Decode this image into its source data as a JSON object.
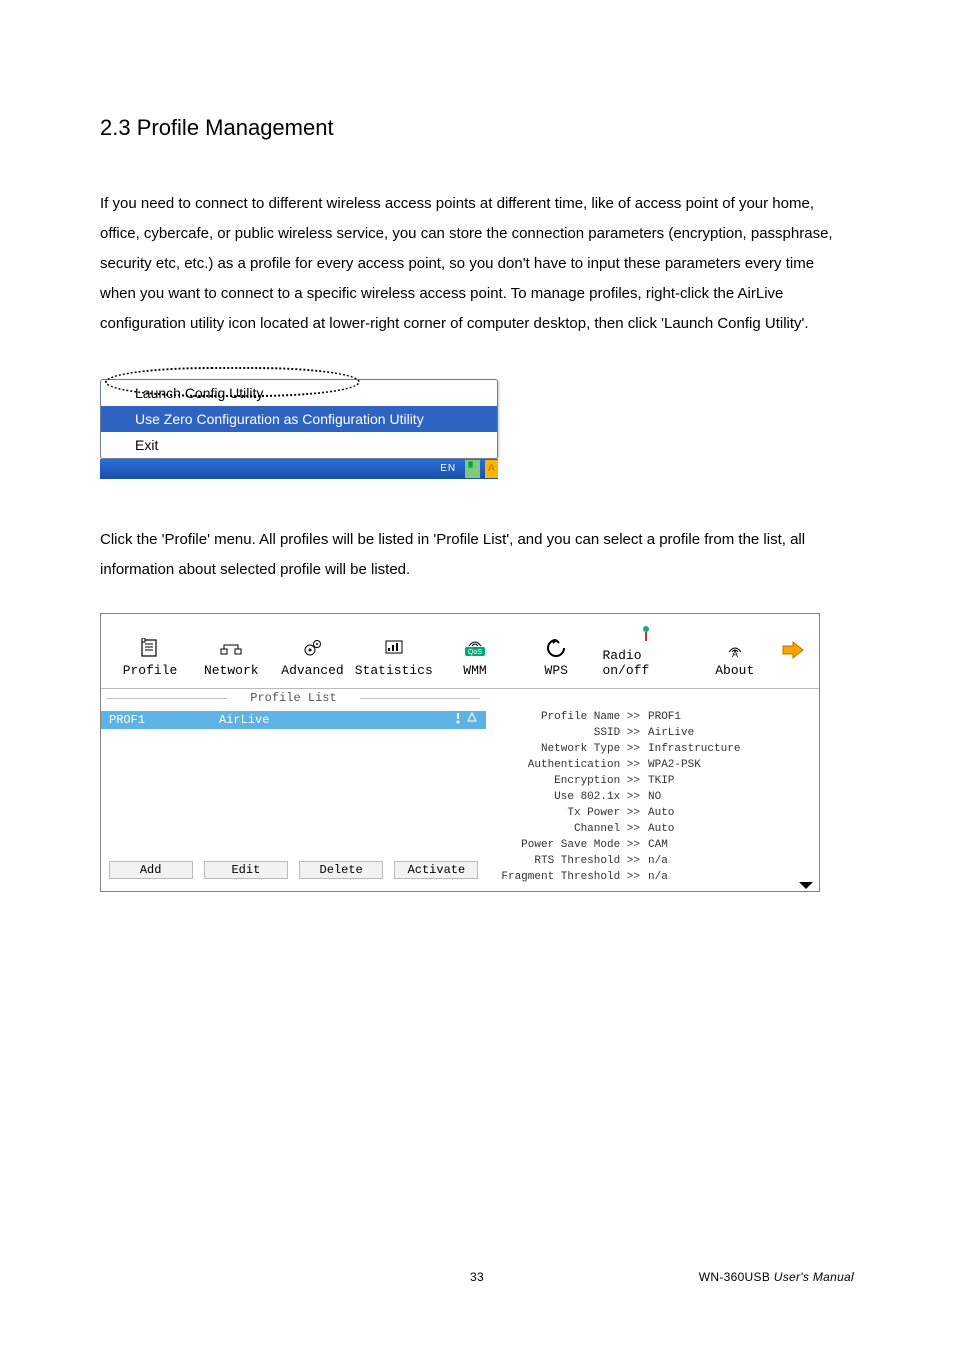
{
  "section": {
    "heading": "2.3 Profile Management"
  },
  "para1": "If you need to connect to different wireless access points at different time, like of access point of your home, office, cybercafe, or public wireless service, you can store the connection parameters (encryption, passphrase, security etc, etc.) as a profile for every access point, so you don't have to input these parameters every time when you want to connect to a specific wireless access point. To manage profiles, right-click the AirLive configuration utility icon located at lower-right corner of computer desktop, then click 'Launch Config Utility'.",
  "tray_menu": {
    "item_launch": "Launch Config Utility",
    "item_zero": "Use Zero Configuration as Configuration Utility",
    "item_exit": "Exit",
    "taskbar_en": "EN"
  },
  "para2": "Click the 'Profile' menu. All profiles will be listed in 'Profile List', and you can select a profile from the list, all information about selected profile will be listed.",
  "toolbar": {
    "profile": "Profile",
    "network": "Network",
    "advanced": "Advanced",
    "statistics": "Statistics",
    "wmm": "WMM",
    "wps": "WPS",
    "radio": "Radio on/off",
    "about": "About"
  },
  "profile_list": {
    "label": "Profile List",
    "row": {
      "name": "PROF1",
      "ssid": "AirLive"
    },
    "btn_add": "Add",
    "btn_edit": "Edit",
    "btn_delete": "Delete",
    "btn_activate": "Activate"
  },
  "details": {
    "profile_name": {
      "l": "Profile Name >>",
      "v": "PROF1"
    },
    "ssid": {
      "l": "SSID >>",
      "v": "AirLive"
    },
    "network_type": {
      "l": "Network Type >>",
      "v": "Infrastructure"
    },
    "auth": {
      "l": "Authentication >>",
      "v": "WPA2-PSK"
    },
    "enc": {
      "l": "Encryption >>",
      "v": "TKIP"
    },
    "use8021x": {
      "l": "Use 802.1x >>",
      "v": "NO"
    },
    "txpower": {
      "l": "Tx Power >>",
      "v": "Auto"
    },
    "channel": {
      "l": "Channel >>",
      "v": "Auto"
    },
    "psm": {
      "l": "Power Save Mode >>",
      "v": "CAM"
    },
    "rts": {
      "l": "RTS Threshold >>",
      "v": "n/a"
    },
    "frag": {
      "l": "Fragment Threshold >>",
      "v": "n/a"
    }
  },
  "chart_data": {
    "type": "table",
    "title": "Profile details",
    "rows": [
      [
        "Profile Name",
        "PROF1"
      ],
      [
        "SSID",
        "AirLive"
      ],
      [
        "Network Type",
        "Infrastructure"
      ],
      [
        "Authentication",
        "WPA2-PSK"
      ],
      [
        "Encryption",
        "TKIP"
      ],
      [
        "Use 802.1x",
        "NO"
      ],
      [
        "Tx Power",
        "Auto"
      ],
      [
        "Channel",
        "Auto"
      ],
      [
        "Power Save Mode",
        "CAM"
      ],
      [
        "RTS Threshold",
        "n/a"
      ],
      [
        "Fragment Threshold",
        "n/a"
      ]
    ]
  },
  "footer": {
    "page": "33",
    "product": "WN-360USB",
    "manual": "  User's Manual"
  }
}
